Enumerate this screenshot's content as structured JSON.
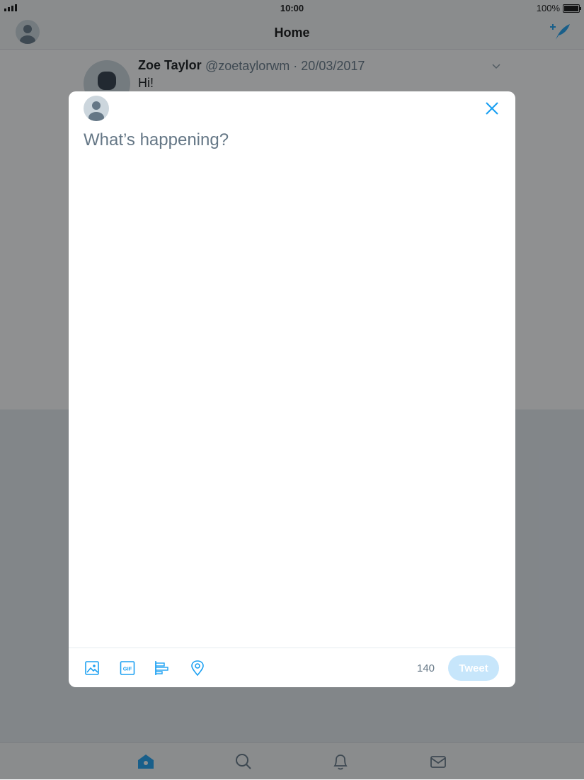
{
  "status_bar": {
    "time": "10:00",
    "battery": "100%"
  },
  "nav": {
    "title": "Home"
  },
  "tweet": {
    "name": "Zoe Taylor",
    "handle_date": "@zoetaylorwm · 20/03/2017",
    "text": "Hi!"
  },
  "compose": {
    "placeholder": "What’s happening?",
    "char_count": "140",
    "tweet_label": "Tweet",
    "gif_label": "GIF",
    "toolbar_icons": [
      "image-icon",
      "gif-icon",
      "poll-icon",
      "location-icon"
    ]
  },
  "tab_bar": {
    "icons": [
      "home-icon",
      "search-icon",
      "notifications-icon",
      "messages-icon"
    ]
  },
  "colors": {
    "accent": "#1da1f2",
    "tweet_disabled": "#c7e6fb",
    "text_secondary": "#657786"
  }
}
